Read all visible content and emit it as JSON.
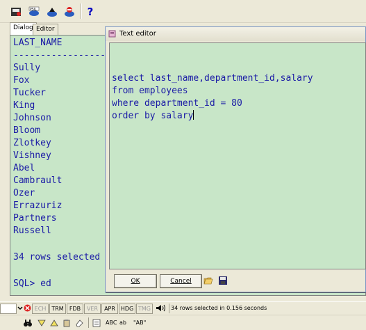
{
  "toolbar": {
    "help_label": "?"
  },
  "tabs": [
    {
      "label": "Dialog"
    },
    {
      "label": "Editor"
    }
  ],
  "output": {
    "header": "LAST_NAME",
    "separator": "------------------------",
    "rows": [
      "Sully",
      "Fox",
      "Tucker",
      "King",
      "Johnson",
      "Bloom",
      "Zlotkey",
      "Vishney",
      "Abel",
      "Cambrault",
      "Ozer",
      "Errazuriz",
      "Partners",
      "Russell"
    ],
    "summary": "34 rows selected",
    "prompt": "SQL> ed"
  },
  "editor": {
    "title": "Text editor",
    "lines": [
      "select last_name,department_id,salary",
      "from employees",
      "where department_id = 80",
      "order by salary"
    ],
    "ok_label": "OK",
    "cancel_label": "Cancel"
  },
  "status": {
    "indicators": [
      {
        "label": "ECH",
        "enabled": false
      },
      {
        "label": "TRM",
        "enabled": true
      },
      {
        "label": "FDB",
        "enabled": true
      },
      {
        "label": "VER",
        "enabled": false
      },
      {
        "label": "APR",
        "enabled": true
      },
      {
        "label": "HDG",
        "enabled": true
      },
      {
        "label": "TMG",
        "enabled": false
      }
    ],
    "message": "34 rows selected in 0.156 seconds"
  },
  "bottom_toolbar": {
    "abc_label": "ABC",
    "ab_label": "ab",
    "ab_quoted_label": "\"AB\""
  },
  "colors": {
    "output_bg": "#c8e6c8",
    "text": "#1a1aa6",
    "chrome": "#ece9d8"
  }
}
